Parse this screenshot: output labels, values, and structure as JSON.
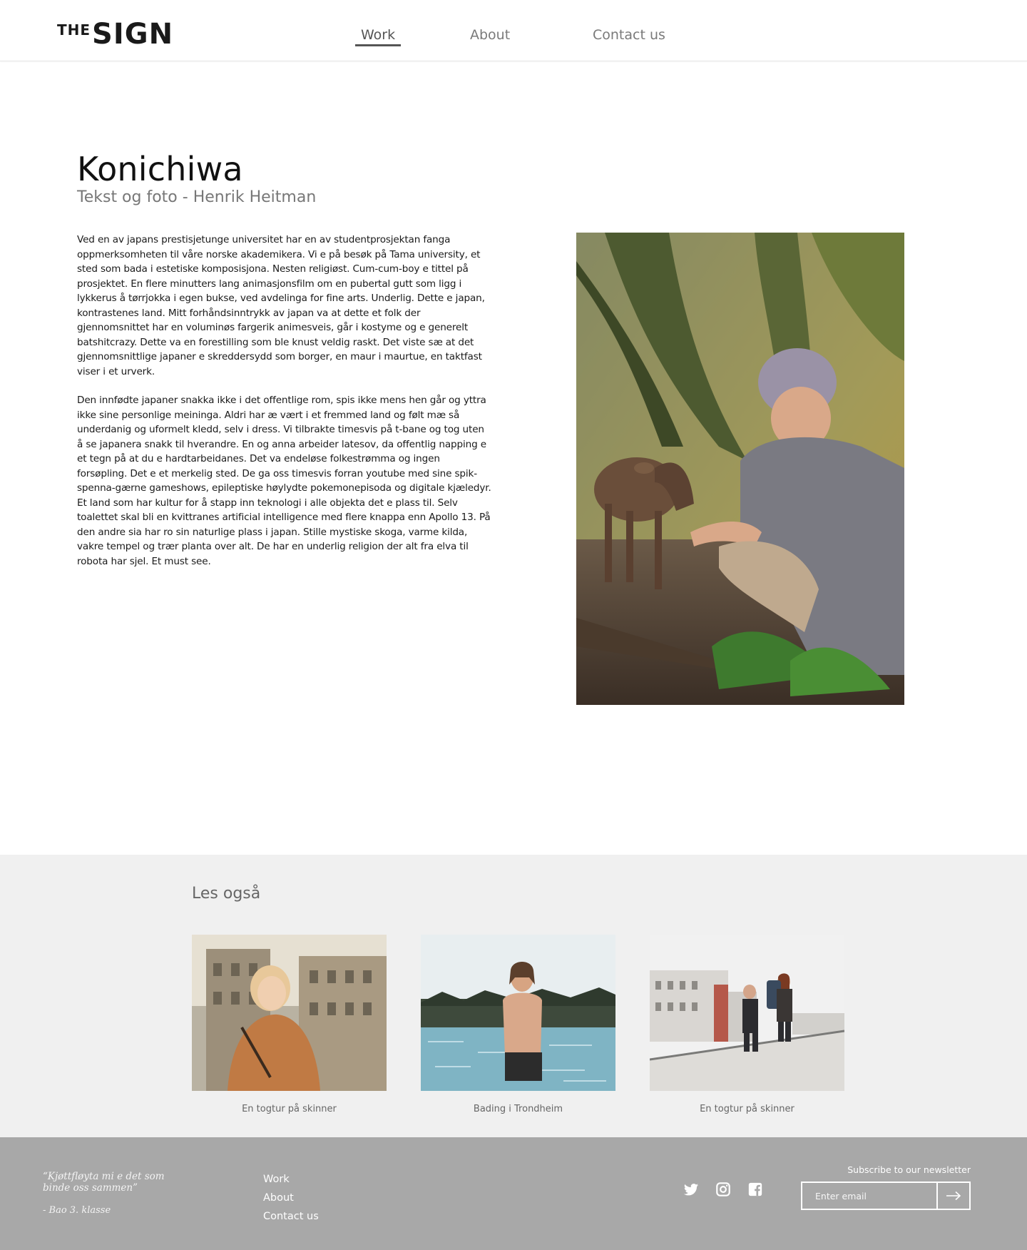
{
  "brand": {
    "the": "THE",
    "sign": "SIGN"
  },
  "nav": [
    {
      "label": "Work",
      "active": true
    },
    {
      "label": "About",
      "active": false
    },
    {
      "label": "Contact us",
      "active": false
    }
  ],
  "article": {
    "title": "Konichiwa",
    "byline": "Tekst og foto - Henrik Heitman",
    "paragraphs": [
      "Ved en av japans prestisjetunge universitet har en av studentprosjektan fanga oppmerksomheten til våre norske akademikera. Vi e på besøk på Tama university, et sted som bada i estetiske komposisjona. Nesten religiøst.  Cum-cum-boy e tittel på prosjektet. En flere minutters lang animasjonsfilm om en pubertal gutt som ligg i lykkerus å tørrjokka i egen bukse, ved avdelinga for fine arts. Underlig. Dette e japan, kontrastenes land. Mitt forhåndsinntrykk av japan va at dette et folk der gjennomsnittet har en voluminøs fargerik animesveis, går i kostyme og e generelt batshitcrazy. Dette va en forestilling som ble knust veldig raskt. Det viste sæ at det gjennomsnittlige japaner e skreddersydd som borger, en maur i maurtue, en taktfast viser i et urverk.",
      "Den innfødte japaner snakka ikke i det offentlige rom, spis ikke mens hen går og yttra ikke sine personlige meininga. Aldri har æ vært i et fremmed land og følt mæ så underdanig og uformelt kledd, selv i dress. Vi tilbrakte timesvis på t-bane og tog uten å se japanera snakk til hverandre.  En og anna arbeider latesov, da offentlig napping e et tegn på at du e hardtarbeidanes. Det va endeløse folkestrømma og ingen forsøpling.  Det e et merkelig sted.  De ga oss timesvis forran youtube med sine spik-spenna-gærne gameshows, epileptiske høylydte pokemonepisoda og digitale kjæledyr. Et land som har kultur for å stapp inn teknologi i alle objekta det e plass til. Selv toalettet skal bli en kvittranes artificial intelligence med flere knappa enn Apollo 13. På den andre sia har ro sin naturlige plass i japan. Stille mystiske skoga, varme kilda, vakre tempel og trær planta over alt. De har en underlig religion der alt fra elva til robota har sjel. Et must see."
    ]
  },
  "related": {
    "title": "Les også",
    "items": [
      {
        "caption": "En togtur på skinner"
      },
      {
        "caption": "Bading i Trondheim"
      },
      {
        "caption": "En togtur på skinner"
      }
    ]
  },
  "footer": {
    "quote": "“Kjøttfløyta mi e det som binde oss sammen”",
    "quote_author": "- Bao 3. klasse",
    "links": [
      "Work",
      "About",
      "Contact us"
    ],
    "social_icons": [
      "twitter-icon",
      "instagram-icon",
      "facebook-icon"
    ],
    "newsletter_label": "Subscribe to our newsletter",
    "newsletter_placeholder": "Enter email"
  },
  "colors": {
    "footer_bg": "#a8a8a8",
    "related_bg": "#f0f0f0",
    "nav_text": "#7a7a7a"
  }
}
